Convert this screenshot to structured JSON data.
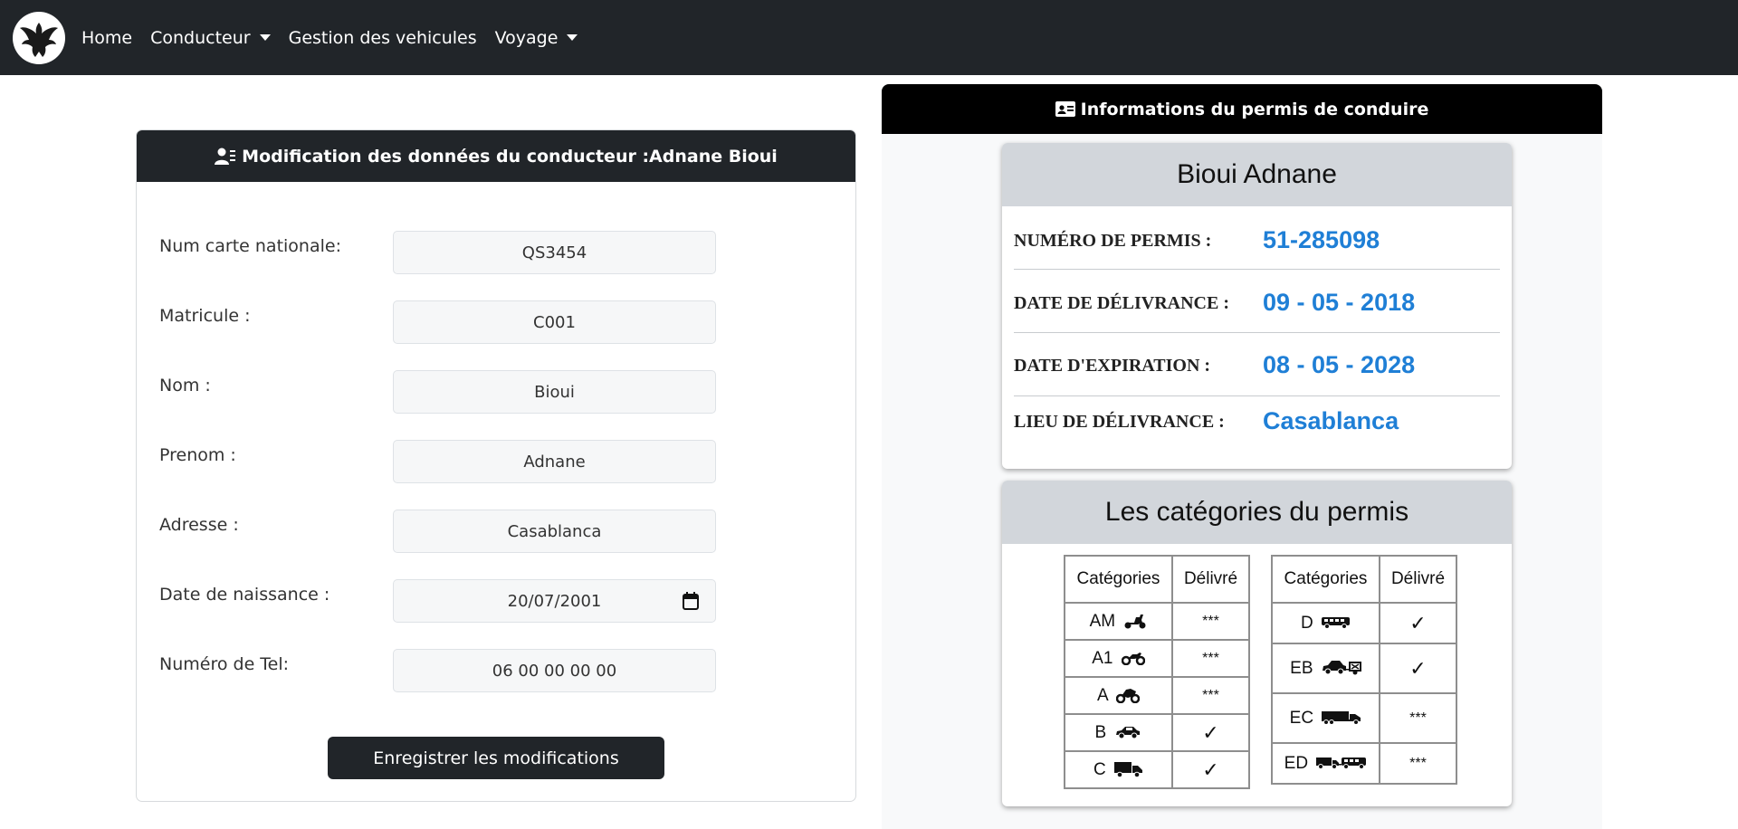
{
  "navbar": {
    "logo_icon": "phoenix-logo",
    "items": [
      {
        "label": "Home",
        "dropdown": false
      },
      {
        "label": "Conducteur",
        "dropdown": true
      },
      {
        "label": "Gestion des vehicules",
        "dropdown": false
      },
      {
        "label": "Voyage",
        "dropdown": true
      }
    ]
  },
  "edit_form": {
    "title": "Modification des données du conducteur :Adnane Bioui",
    "fields": [
      {
        "label": "Num carte nationale:",
        "value": "QS3454"
      },
      {
        "label": "Matricule :",
        "value": "C001"
      },
      {
        "label": "Nom :",
        "value": "Bioui"
      },
      {
        "label": "Prenom :",
        "value": "Adnane"
      },
      {
        "label": "Adresse :",
        "value": "Casablanca"
      },
      {
        "label": "Date de naissance :",
        "value": "20/07/2001"
      },
      {
        "label": "Numéro de Tel:",
        "value": "06 00 00 00 00"
      }
    ],
    "save_label": "Enregistrer les modifications"
  },
  "license": {
    "title": "Informations du permis de conduire",
    "holder_name": "Bioui Adnane",
    "rows": [
      {
        "label": "NUMÉRO DE PERMIS :",
        "value": "51-285098"
      },
      {
        "label": "DATE DE DÉLIVRANCE :",
        "value": "09 - 05 - 2018"
      },
      {
        "label": "DATE D'EXPIRATION :",
        "value": "08 - 05 - 2028"
      },
      {
        "label": "LIEU DE DÉLIVRANCE :",
        "value": "Casablanca"
      }
    ],
    "value_color": "#1f7fd6"
  },
  "categories": {
    "title": "Les catégories du permis",
    "col_category": "Catégories",
    "col_delivered": "Délivré",
    "left_table": [
      {
        "code": "AM",
        "icon": "scooter-icon",
        "delivered": "***"
      },
      {
        "code": "A1",
        "icon": "light-motorcycle-icon",
        "delivered": "***"
      },
      {
        "code": "A",
        "icon": "motorcycle-icon",
        "delivered": "***"
      },
      {
        "code": "B",
        "icon": "car-icon",
        "delivered": "✓"
      },
      {
        "code": "C",
        "icon": "truck-icon",
        "delivered": "✓"
      }
    ],
    "right_table": [
      {
        "code": "D",
        "icon": "bus-icon",
        "delivered": "✓"
      },
      {
        "code": "EB",
        "icon": "car-trailer-icon",
        "delivered": "✓"
      },
      {
        "code": "EC",
        "icon": "semi-truck-icon",
        "delivered": "***"
      },
      {
        "code": "ED",
        "icon": "bus-trailer-icon",
        "delivered": "***"
      }
    ]
  }
}
